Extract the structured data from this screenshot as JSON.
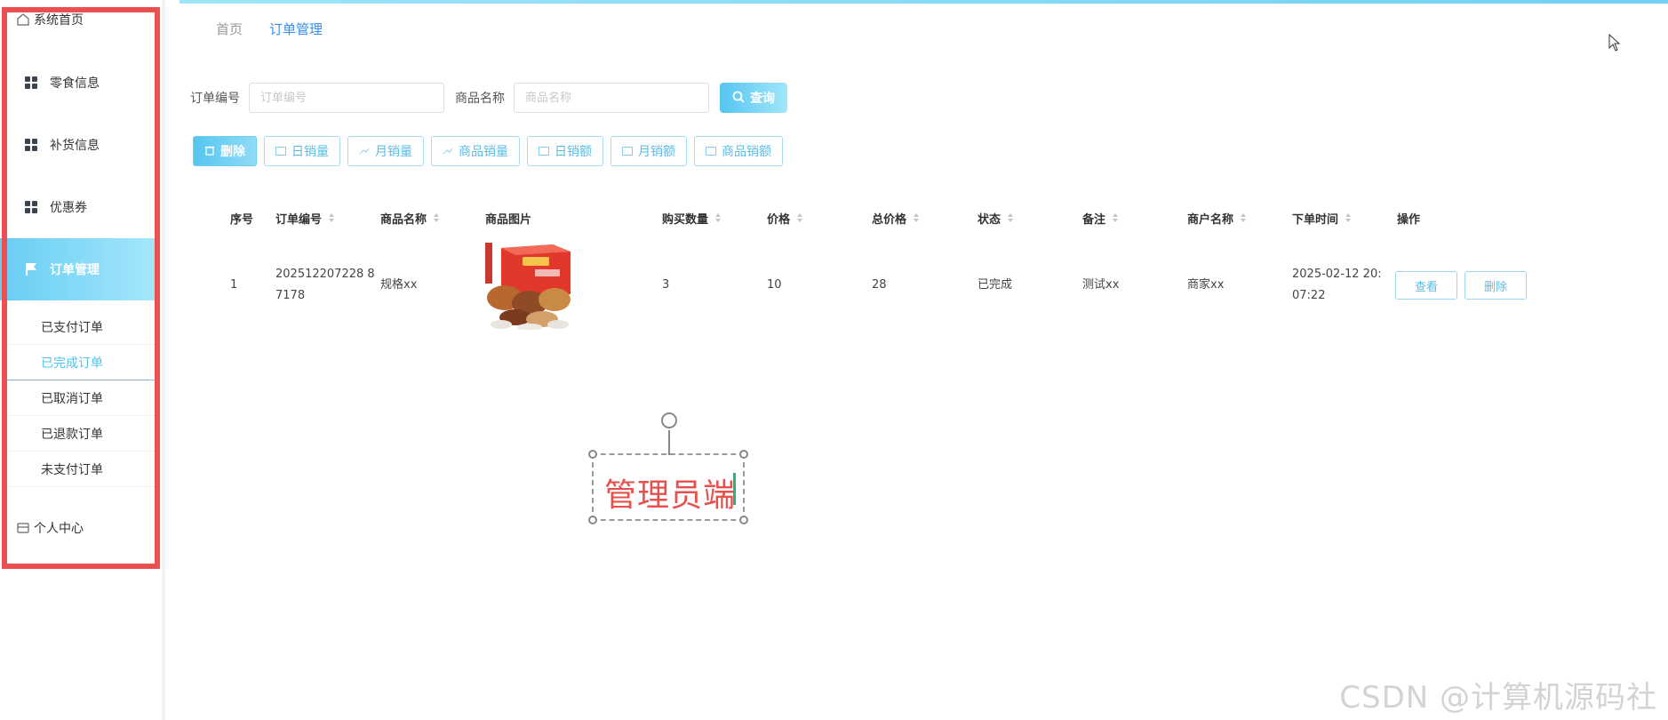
{
  "sidebar": {
    "home": "系统首页",
    "items": [
      {
        "label": "零食信息"
      },
      {
        "label": "补货信息"
      },
      {
        "label": "优惠券"
      },
      {
        "label": "订单管理"
      }
    ],
    "sub_items": [
      {
        "label": "已支付订单"
      },
      {
        "label": "已完成订单"
      },
      {
        "label": "已取消订单"
      },
      {
        "label": "已退款订单"
      },
      {
        "label": "未支付订单"
      }
    ],
    "profile": "个人中心"
  },
  "breadcrumb": {
    "home": "首页",
    "current": "订单管理"
  },
  "search": {
    "order_label": "订单编号",
    "order_placeholder": "订单编号",
    "goods_label": "商品名称",
    "goods_placeholder": "商品名称",
    "query_label": "查询"
  },
  "toolbar": {
    "delete": "删除",
    "daily_volume": "日销量",
    "monthly_volume": "月销量",
    "goods_volume": "商品销量",
    "daily_amount": "日销额",
    "monthly_amount": "月销额",
    "goods_amount": "商品销额"
  },
  "table": {
    "headers": [
      "序号",
      "订单编号",
      "商品名称",
      "商品图片",
      "购买数量",
      "价格",
      "总价格",
      "状态",
      "备注",
      "商户名称",
      "下单时间",
      "操作"
    ],
    "rows": [
      {
        "index": "1",
        "order_no": "202512207228 87178",
        "goods_name": "规格xx",
        "quantity": "3",
        "price": "10",
        "total": "28",
        "status": "已完成",
        "remark": "测试xx",
        "merchant": "商家xx",
        "time": "2025-02-12 20:07:22",
        "view_label": "查看",
        "delete_label": "删除"
      }
    ]
  },
  "annotation": {
    "text": "管理员端"
  },
  "watermark": "CSDN @计算机源码社",
  "colors": {
    "accent": "#59bde6",
    "outline": "#ee4e50",
    "annotation_text": "#e8504e"
  }
}
